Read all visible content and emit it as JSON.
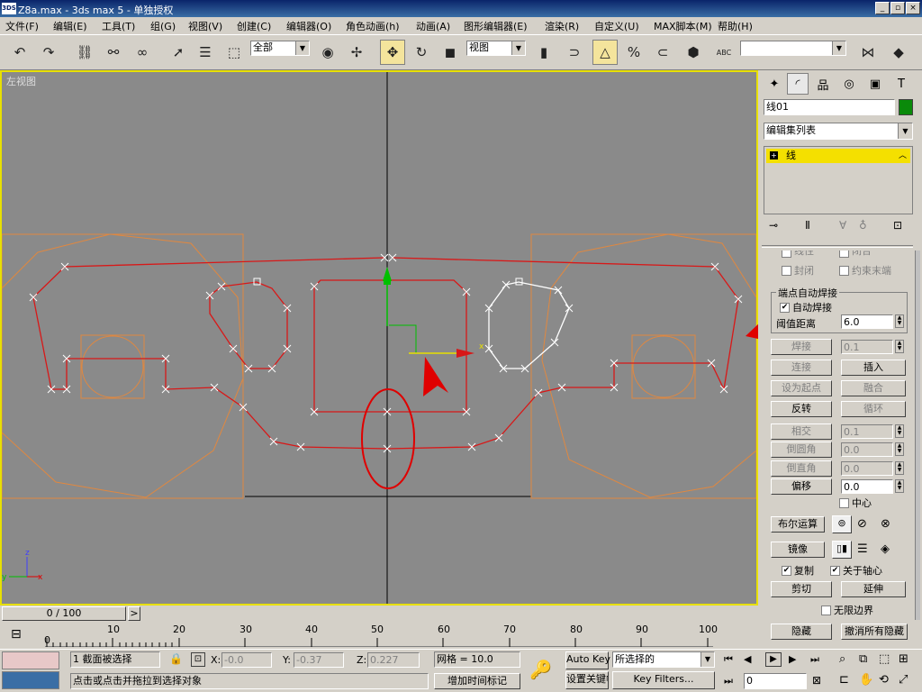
{
  "app": {
    "title": "Z8a.max - 3ds max 5 - 单独授权",
    "logo_text": "3DS"
  },
  "window_buttons": {
    "minimize": "_",
    "restore": "▫",
    "close": "×"
  },
  "menu": [
    "文件(F)",
    "编辑(E)",
    "工具(T)",
    "组(G)",
    "视图(V)",
    "创建(C)",
    "编辑器(O)",
    "角色动画(h)",
    "动画(A)",
    "图形编辑器(E)",
    "渲染(R)",
    "自定义(U)",
    "MAX脚本(M)",
    "帮助(H)"
  ],
  "toolbar": {
    "selection_filter": "全部",
    "reference_coord": "视图",
    "named_selection": "",
    "abc_label": "ABC"
  },
  "viewport": {
    "label": "左视图",
    "axis_labels": {
      "z": "z",
      "y": "y",
      "x": "x"
    }
  },
  "command_panel": {
    "object_name": "线01",
    "object_color": "#0a8a0a",
    "modifier_list_label": "编辑集列表",
    "stack_item": "线",
    "stack_item_expand": "+",
    "checkboxes_top": [
      {
        "label": "线性",
        "checked": false
      },
      {
        "label": "闭合",
        "checked": false
      },
      {
        "label": "封闭",
        "checked": false
      },
      {
        "label": "约束末端",
        "checked": false
      }
    ],
    "autoweld": {
      "group_title": "端点自动焊接",
      "checkbox_label": "自动焊接",
      "checked": true,
      "threshold_label": "阈值距离",
      "threshold_value": "6.0"
    },
    "buttons": {
      "weld": "焊接",
      "weld_value": "0.1",
      "connect": "连接",
      "insert": "插入",
      "make_first": "设为起点",
      "fuse": "融合",
      "reverse": "反转",
      "cycle": "循环",
      "crossinsert": "相交",
      "crossinsert_value": "0.1",
      "fillet": "倒圆角",
      "fillet_value": "0.0",
      "chamfer": "倒直角",
      "chamfer_value": "0.0",
      "outline": "偏移",
      "outline_value": "0.0",
      "center_label": "中心",
      "boolean": "布尔运算",
      "mirror": "镜像",
      "copy_label": "复制",
      "copy_checked": true,
      "about_pivot_label": "关于轴心",
      "about_pivot_checked": true,
      "trim": "剪切",
      "extend": "延伸",
      "infinite_bounds_label": "无限边界",
      "hide": "隐藏",
      "unhide_all": "撤消所有隐藏"
    }
  },
  "time_slider": {
    "label": "0 / 100",
    "prev": "<",
    "next": ">"
  },
  "track_ticks": [
    "0",
    "10",
    "20",
    "30",
    "40",
    "50",
    "60",
    "70",
    "80",
    "90",
    "100"
  ],
  "status": {
    "selection_count": "1 截面被选择",
    "prompt": "点击或点击并拖拉到选择对象",
    "x_label": "X:",
    "x_value": "-0.0",
    "y_label": "Y:",
    "y_value": "-0.37",
    "z_label": "Z:",
    "z_value": "0.227",
    "grid": "网格 = 10.0",
    "add_time_tag": "增加时间标记",
    "auto_key": "Auto Key",
    "auto_key_selected": "所选择的",
    "set_key": "设置关键帧",
    "key_filters": "Key Filters...",
    "frame_value": "0"
  },
  "colors": {
    "accent_yellow": "#e8e000",
    "spline_red": "#d81818",
    "ref_orange": "#e08840",
    "annotation_red": "#e00000",
    "viewport_bg": "#8a8a8a"
  }
}
